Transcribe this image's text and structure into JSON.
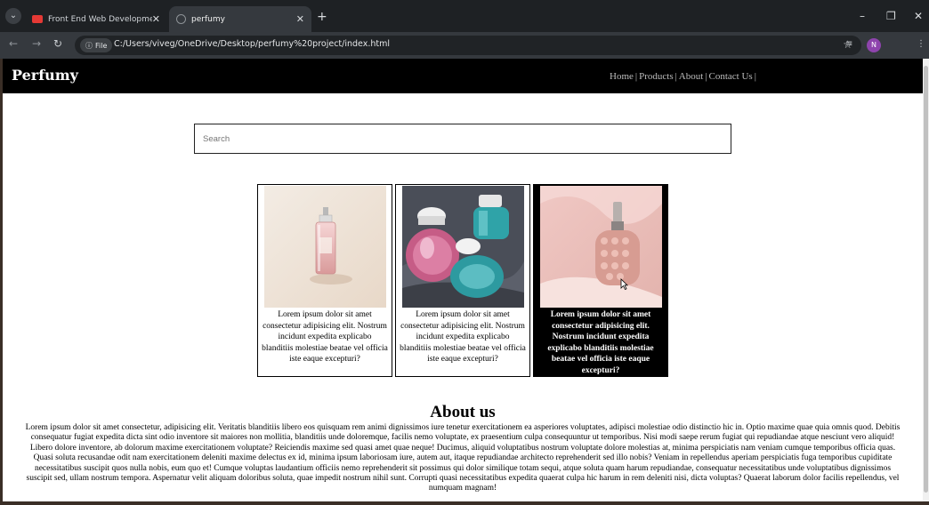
{
  "browser": {
    "tabs": [
      {
        "title": "Front End Web Development T",
        "favicon": "youtube-icon",
        "active": false
      },
      {
        "title": "perfumy",
        "favicon": "globe-icon",
        "active": true
      }
    ],
    "address": {
      "chip_label": "File",
      "url": "C:/Users/viveg/OneDrive/Desktop/perfumy%20project/index.html"
    },
    "profile_initial": "N"
  },
  "site": {
    "brand": "Perfumy",
    "nav": [
      "Home",
      "Products",
      "About",
      "Contact Us"
    ],
    "search": {
      "placeholder": "Search"
    },
    "products": [
      {
        "description": "Lorem ipsum dolor sit amet consectetur adipisicing elit. Nostrum incidunt expedita explicabo blanditiis molestiae beatae vel officia iste eaque excepturi?"
      },
      {
        "description": "Lorem ipsum dolor sit amet consectetur adipisicing elit. Nostrum incidunt expedita explicabo blanditiis molestiae beatae vel officia iste eaque excepturi?"
      },
      {
        "description": "Lorem ipsum dolor sit amet consectetur adipisicing elit. Nostrum incidunt expedita explicabo blanditiis molestiae beatae vel officia iste eaque excepturi?",
        "hovered": true
      }
    ],
    "about": {
      "title": "About us",
      "text": "Lorem ipsum dolor sit amet consectetur, adipisicing elit. Veritatis blanditiis libero eos quisquam rem animi dignissimos iure tenetur exercitationem ea asperiores voluptates, adipisci molestiae odio distinctio hic in. Optio maxime quae quia omnis quod. Debitis consequatur fugiat expedita dicta sint odio inventore sit maiores non mollitia, blanditiis unde doloremque, facilis nemo voluptate, ex praesentium culpa consequuntur ut temporibus. Nisi modi saepe rerum fugiat qui repudiandae atque nesciunt vero aliquid! Libero dolore inventore, ab dolorum maxime exercitationem voluptate? Reiciendis maxime sed quasi amet quae neque! Ducimus, aliquid voluptatibus nostrum voluptate dolore molestias at, minima perspiciatis nam veniam cumque temporibus officia quas. Quasi soluta recusandae odit nam exercitationem deleniti maxime delectus ex id, minima ipsum laboriosam iure, autem aut, itaque repudiandae architecto reprehenderit sed illo nobis? Veniam in repellendus aperiam perspiciatis fuga temporibus cupiditate necessitatibus suscipit quos nulla nobis, eum quo et! Cumque voluptas laudantium officiis nemo reprehenderit sit possimus qui dolor similique totam sequi, atque soluta quam harum repudiandae, consequatur necessitatibus unde voluptatibus dignissimos suscipit sed, ullam nostrum tempora. Aspernatur velit aliquam doloribus soluta, quae impedit nostrum nihil sunt. Corrupti quasi necessitatibus expedita quaerat culpa hic harum in rem deleniti nisi, dicta voluptas? Quaerat laborum dolor facilis repellendus, vel numquam magnam!"
    }
  },
  "colors": {
    "nav_bg": "#000000",
    "page_bg": "#ffffff",
    "brand_text": "#ffffff",
    "nav_link": "#bdbdbd",
    "hover_card_bg": "#000000"
  }
}
